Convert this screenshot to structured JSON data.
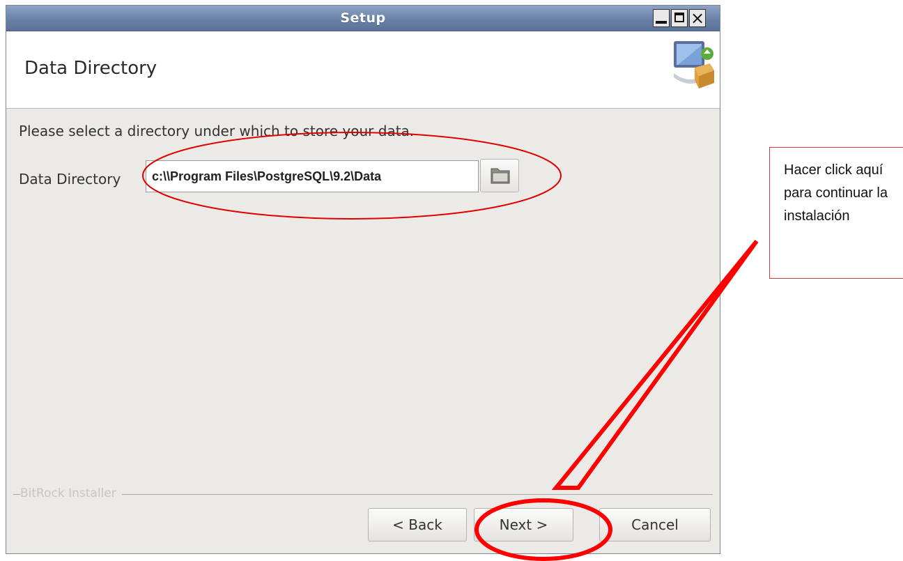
{
  "window": {
    "title": "Setup",
    "controls": [
      "minimize",
      "maximize",
      "close"
    ],
    "close_glyph": "×"
  },
  "header": {
    "title": "Data Directory",
    "icon": "installer-computer-package-icon"
  },
  "content": {
    "instructions": "Please select a directory under which to store your data.",
    "dir_label": "Data Directory",
    "dir_value": "c:\\\\Program Files\\PostgreSQL\\9.2\\Data",
    "browse_icon": "folder-icon"
  },
  "footer": {
    "brand": "BitRock Installer",
    "back_label": "< Back",
    "next_label": "Next >",
    "cancel_label": "Cancel"
  },
  "annotation": {
    "callout_text": "Hacer click aquí para continuar la instalación",
    "color": "#ff0000"
  }
}
